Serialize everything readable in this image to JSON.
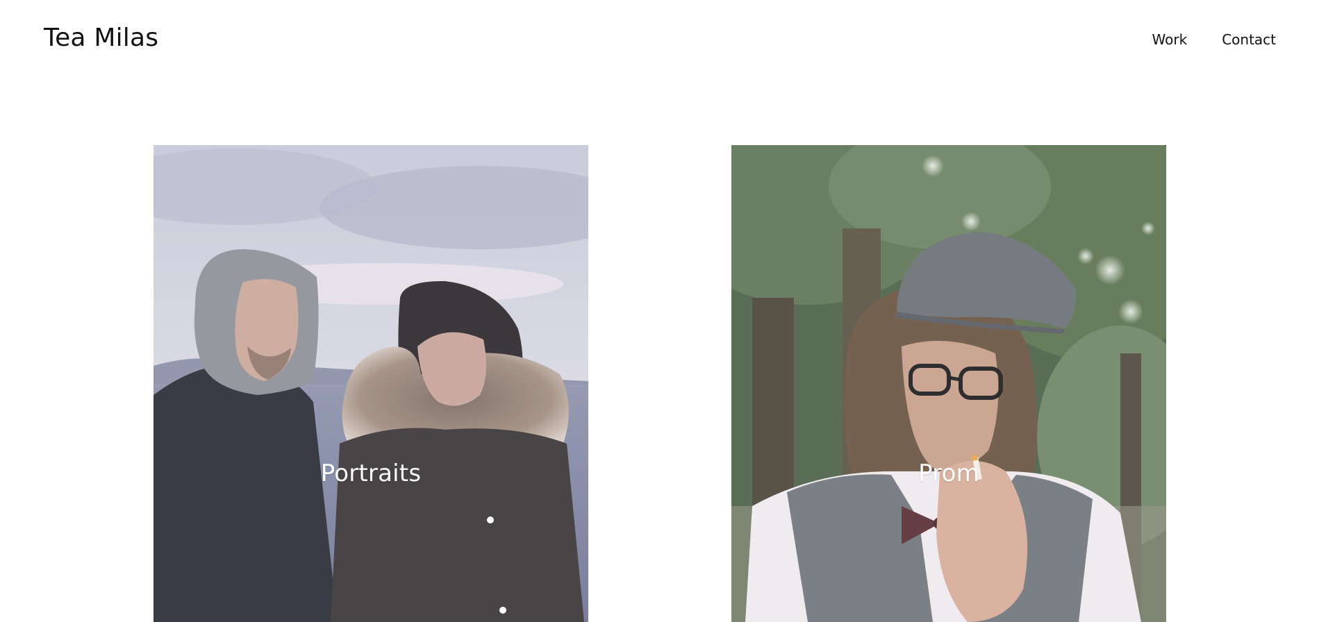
{
  "header": {
    "site_title": "Tea Milas",
    "nav": {
      "work": "Work",
      "contact": "Contact"
    }
  },
  "gallery": {
    "items": [
      {
        "title": "Portraits"
      },
      {
        "title": "Prom"
      }
    ]
  },
  "colors": {
    "page_background": "#ffffff",
    "text": "#111111",
    "overlay_text": "#ffffff"
  }
}
